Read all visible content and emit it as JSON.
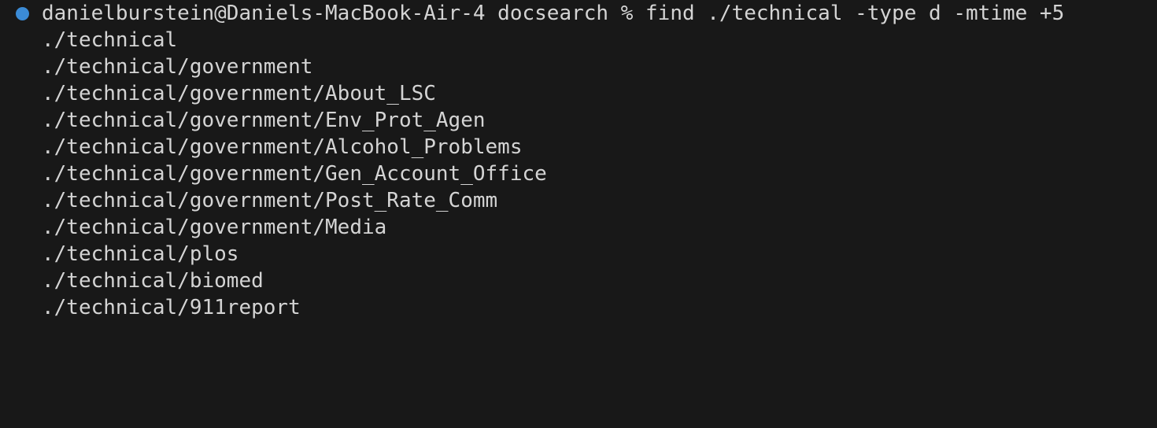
{
  "terminal": {
    "status_indicator": "circle-icon",
    "command": {
      "prompt": "danielburstein@Daniels-MacBook-Air-4 docsearch % ",
      "text": "find ./technical -type d -mtime +5"
    },
    "output": [
      "./technical",
      "./technical/government",
      "./technical/government/About_LSC",
      "./technical/government/Env_Prot_Agen",
      "./technical/government/Alcohol_Problems",
      "./technical/government/Gen_Account_Office",
      "./technical/government/Post_Rate_Comm",
      "./technical/government/Media",
      "./technical/plos",
      "./technical/biomed",
      "./technical/911report"
    ]
  },
  "colors": {
    "background": "#181818",
    "foreground": "#d4d4d4",
    "status_dot": "#3b8bd6"
  }
}
